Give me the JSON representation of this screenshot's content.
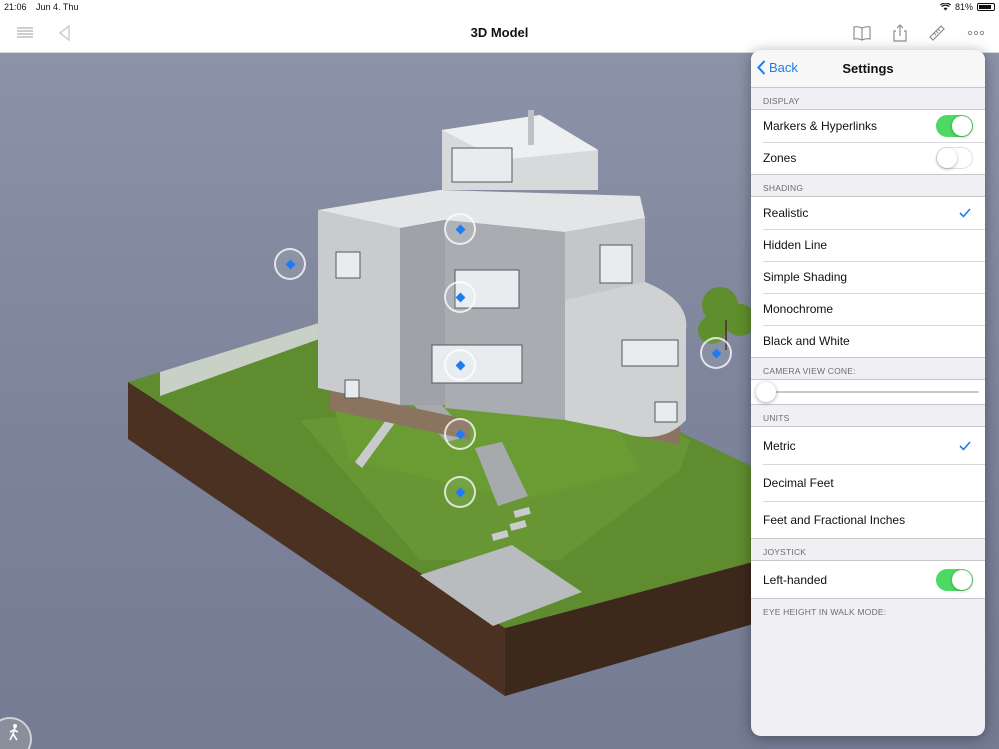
{
  "status_bar": {
    "time": "21:06",
    "date": "Jun 4. Thu",
    "battery": "81%"
  },
  "nav": {
    "title": "3D Model",
    "left_icons": [
      "menu-icon",
      "back-triangle-icon"
    ],
    "right_icons": [
      "book-icon",
      "share-icon",
      "ruler-icon",
      "more-icon"
    ]
  },
  "settings": {
    "back_label": "Back",
    "title": "Settings",
    "display": {
      "label": "DISPLAY",
      "rows": [
        {
          "label": "Markers & Hyperlinks",
          "on": true
        },
        {
          "label": "Zones",
          "on": false
        }
      ]
    },
    "shading": {
      "label": "SHADING",
      "options": [
        "Realistic",
        "Hidden Line",
        "Simple Shading",
        "Monochrome",
        "Black and White"
      ],
      "selected": "Realistic"
    },
    "camera": {
      "label": "CAMERA VIEW CONE:",
      "value": 0
    },
    "units": {
      "label": "UNITS",
      "options": [
        "Metric",
        "Decimal Feet",
        "Feet and Fractional Inches"
      ],
      "selected": "Metric"
    },
    "joystick": {
      "label": "JOYSTICK",
      "rows": [
        {
          "label": "Left-handed",
          "on": true
        }
      ]
    },
    "eye_height": {
      "label": "EYE HEIGHT IN WALK MODE:"
    }
  },
  "colors": {
    "accent": "#1e7bf0",
    "toggle_on": "#4cd964"
  }
}
